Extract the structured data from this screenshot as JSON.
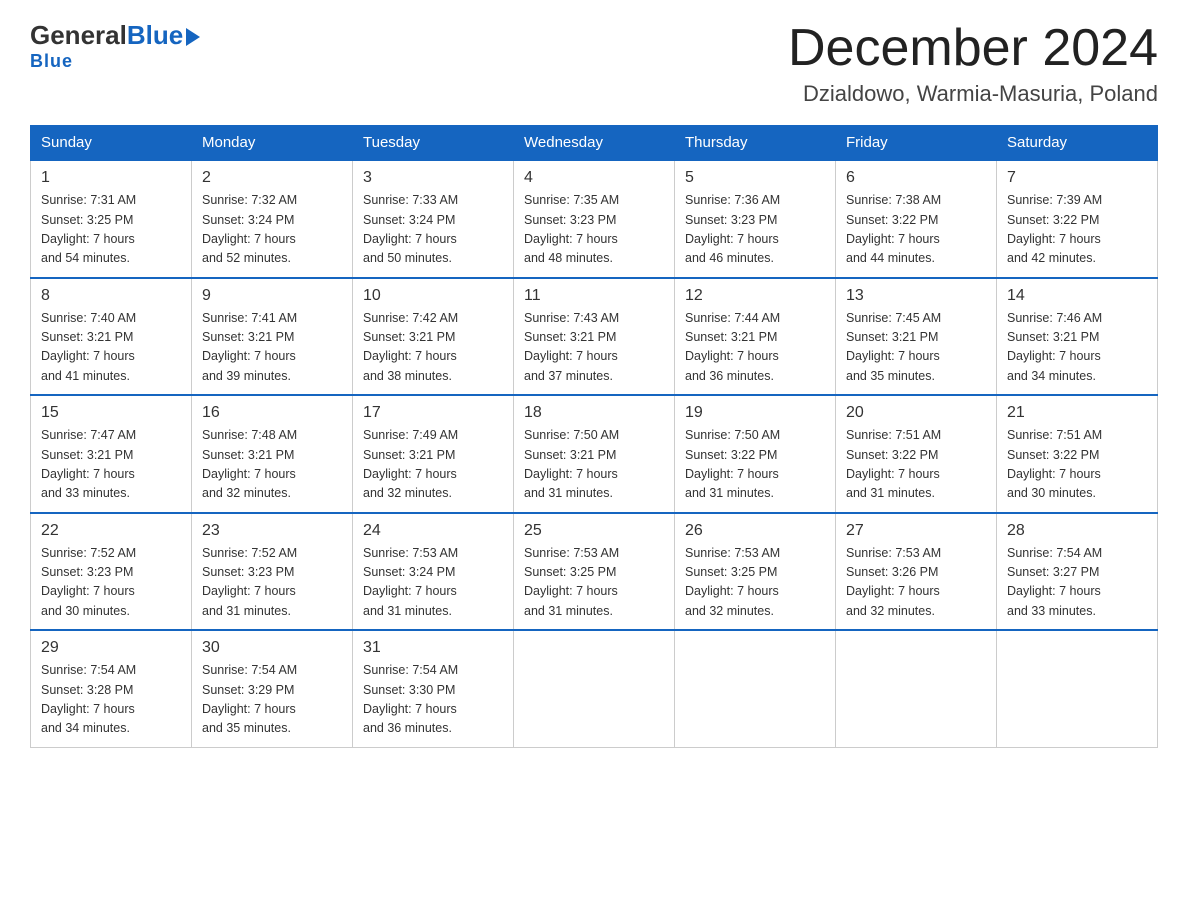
{
  "header": {
    "logo_general": "General",
    "logo_blue": "Blue",
    "month_title": "December 2024",
    "location": "Dzialdowo, Warmia-Masuria, Poland"
  },
  "days_of_week": [
    "Sunday",
    "Monday",
    "Tuesday",
    "Wednesday",
    "Thursday",
    "Friday",
    "Saturday"
  ],
  "weeks": [
    [
      {
        "day": "1",
        "sunrise": "7:31 AM",
        "sunset": "3:25 PM",
        "daylight": "7 hours and 54 minutes."
      },
      {
        "day": "2",
        "sunrise": "7:32 AM",
        "sunset": "3:24 PM",
        "daylight": "7 hours and 52 minutes."
      },
      {
        "day": "3",
        "sunrise": "7:33 AM",
        "sunset": "3:24 PM",
        "daylight": "7 hours and 50 minutes."
      },
      {
        "day": "4",
        "sunrise": "7:35 AM",
        "sunset": "3:23 PM",
        "daylight": "7 hours and 48 minutes."
      },
      {
        "day": "5",
        "sunrise": "7:36 AM",
        "sunset": "3:23 PM",
        "daylight": "7 hours and 46 minutes."
      },
      {
        "day": "6",
        "sunrise": "7:38 AM",
        "sunset": "3:22 PM",
        "daylight": "7 hours and 44 minutes."
      },
      {
        "day": "7",
        "sunrise": "7:39 AM",
        "sunset": "3:22 PM",
        "daylight": "7 hours and 42 minutes."
      }
    ],
    [
      {
        "day": "8",
        "sunrise": "7:40 AM",
        "sunset": "3:21 PM",
        "daylight": "7 hours and 41 minutes."
      },
      {
        "day": "9",
        "sunrise": "7:41 AM",
        "sunset": "3:21 PM",
        "daylight": "7 hours and 39 minutes."
      },
      {
        "day": "10",
        "sunrise": "7:42 AM",
        "sunset": "3:21 PM",
        "daylight": "7 hours and 38 minutes."
      },
      {
        "day": "11",
        "sunrise": "7:43 AM",
        "sunset": "3:21 PM",
        "daylight": "7 hours and 37 minutes."
      },
      {
        "day": "12",
        "sunrise": "7:44 AM",
        "sunset": "3:21 PM",
        "daylight": "7 hours and 36 minutes."
      },
      {
        "day": "13",
        "sunrise": "7:45 AM",
        "sunset": "3:21 PM",
        "daylight": "7 hours and 35 minutes."
      },
      {
        "day": "14",
        "sunrise": "7:46 AM",
        "sunset": "3:21 PM",
        "daylight": "7 hours and 34 minutes."
      }
    ],
    [
      {
        "day": "15",
        "sunrise": "7:47 AM",
        "sunset": "3:21 PM",
        "daylight": "7 hours and 33 minutes."
      },
      {
        "day": "16",
        "sunrise": "7:48 AM",
        "sunset": "3:21 PM",
        "daylight": "7 hours and 32 minutes."
      },
      {
        "day": "17",
        "sunrise": "7:49 AM",
        "sunset": "3:21 PM",
        "daylight": "7 hours and 32 minutes."
      },
      {
        "day": "18",
        "sunrise": "7:50 AM",
        "sunset": "3:21 PM",
        "daylight": "7 hours and 31 minutes."
      },
      {
        "day": "19",
        "sunrise": "7:50 AM",
        "sunset": "3:22 PM",
        "daylight": "7 hours and 31 minutes."
      },
      {
        "day": "20",
        "sunrise": "7:51 AM",
        "sunset": "3:22 PM",
        "daylight": "7 hours and 31 minutes."
      },
      {
        "day": "21",
        "sunrise": "7:51 AM",
        "sunset": "3:22 PM",
        "daylight": "7 hours and 30 minutes."
      }
    ],
    [
      {
        "day": "22",
        "sunrise": "7:52 AM",
        "sunset": "3:23 PM",
        "daylight": "7 hours and 30 minutes."
      },
      {
        "day": "23",
        "sunrise": "7:52 AM",
        "sunset": "3:23 PM",
        "daylight": "7 hours and 31 minutes."
      },
      {
        "day": "24",
        "sunrise": "7:53 AM",
        "sunset": "3:24 PM",
        "daylight": "7 hours and 31 minutes."
      },
      {
        "day": "25",
        "sunrise": "7:53 AM",
        "sunset": "3:25 PM",
        "daylight": "7 hours and 31 minutes."
      },
      {
        "day": "26",
        "sunrise": "7:53 AM",
        "sunset": "3:25 PM",
        "daylight": "7 hours and 32 minutes."
      },
      {
        "day": "27",
        "sunrise": "7:53 AM",
        "sunset": "3:26 PM",
        "daylight": "7 hours and 32 minutes."
      },
      {
        "day": "28",
        "sunrise": "7:54 AM",
        "sunset": "3:27 PM",
        "daylight": "7 hours and 33 minutes."
      }
    ],
    [
      {
        "day": "29",
        "sunrise": "7:54 AM",
        "sunset": "3:28 PM",
        "daylight": "7 hours and 34 minutes."
      },
      {
        "day": "30",
        "sunrise": "7:54 AM",
        "sunset": "3:29 PM",
        "daylight": "7 hours and 35 minutes."
      },
      {
        "day": "31",
        "sunrise": "7:54 AM",
        "sunset": "3:30 PM",
        "daylight": "7 hours and 36 minutes."
      },
      null,
      null,
      null,
      null
    ]
  ],
  "labels": {
    "sunrise_prefix": "Sunrise: ",
    "sunset_prefix": "Sunset: ",
    "daylight_prefix": "Daylight: "
  }
}
